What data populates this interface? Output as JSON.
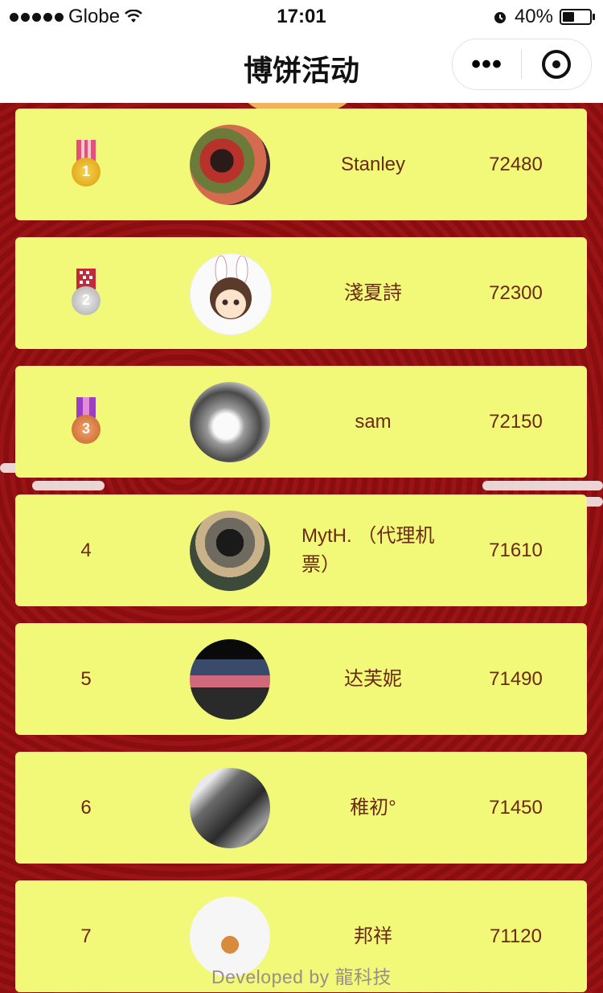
{
  "status_bar": {
    "carrier": "Globe",
    "time": "17:01",
    "battery": "40%"
  },
  "navbar": {
    "title": "博饼活动",
    "more_label": "•••"
  },
  "leaderboard": [
    {
      "rank": "1",
      "medal": "gold-medal-icon",
      "name": "Stanley",
      "score": "72480"
    },
    {
      "rank": "2",
      "medal": "silver-medal-icon",
      "name": "淺夏詩",
      "score": "72300"
    },
    {
      "rank": "3",
      "medal": "bronze-medal-icon",
      "name": "sam",
      "score": "72150"
    },
    {
      "rank": "4",
      "medal": "",
      "name": "MytH. （代理机票）",
      "score": "71610"
    },
    {
      "rank": "5",
      "medal": "",
      "name": "达芙妮",
      "score": "71490"
    },
    {
      "rank": "6",
      "medal": "",
      "name": "稚初°",
      "score": "71450"
    },
    {
      "rank": "7",
      "medal": "",
      "name": "邦祥",
      "score": "71120"
    }
  ],
  "footer": "Developed by 龍科技",
  "colors": {
    "row_bg": "#f2f878",
    "text": "#6b2a12",
    "page_bg": "#8e0f12"
  }
}
